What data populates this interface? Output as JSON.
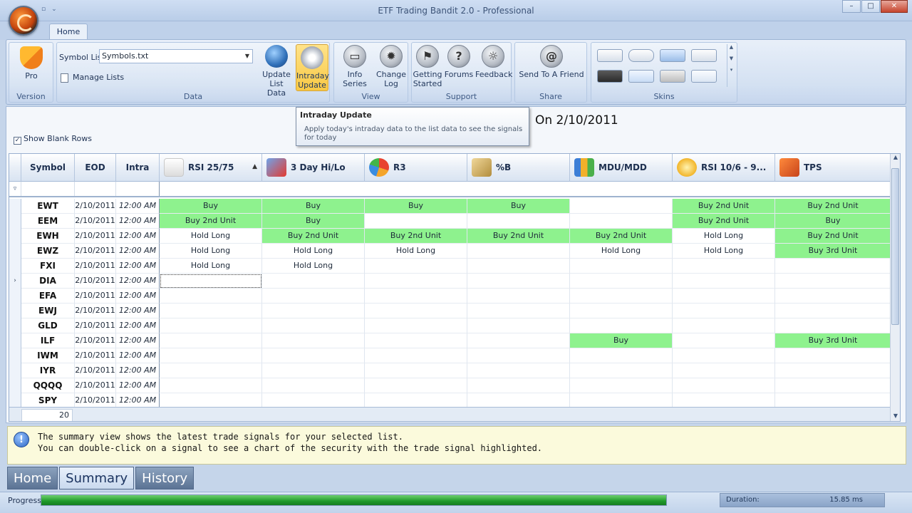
{
  "window": {
    "title": "ETF Trading Bandit 2.0 - Professional",
    "min": "–",
    "max": "□",
    "close": "✕"
  },
  "ribbon": {
    "tab": "Home",
    "groups": {
      "version": {
        "label": "Version",
        "pro": "Pro"
      },
      "data": {
        "label": "Data",
        "symbol_list_label": "Symbol List",
        "symbol_list_value": "Symbols.txt",
        "manage_lists": "Manage Lists",
        "update_list_1": "Update",
        "update_list_2": "List Data",
        "intraday_1": "Intraday",
        "intraday_2": "Update"
      },
      "view": {
        "label": "View",
        "info_series": "Info Series",
        "change_log_1": "Change",
        "change_log_2": "Log"
      },
      "support": {
        "label": "Support",
        "getting_started_1": "Getting",
        "getting_started_2": "Started",
        "forums": "Forums",
        "feedback": "Feedback"
      },
      "share": {
        "label": "Share",
        "send": "Send To A Friend",
        "at": "@"
      },
      "skins": {
        "label": "Skins"
      }
    }
  },
  "tooltip": {
    "title": "Intraday Update",
    "body": "Apply today's intraday data to the list data to see the signals for today"
  },
  "header_date": "On 2/10/2011",
  "show_blank_rows": "Show Blank Rows",
  "columns": {
    "symbol": "Symbol",
    "eod": "EOD",
    "intra": "Intra",
    "rsi2575": "RSI 25/75",
    "hilo": "3 Day Hi/Lo",
    "r3": "R3",
    "pctb": "%B",
    "mdu": "MDU/MDD",
    "rsi106": "RSI 10/6 - 9...",
    "tps": "TPS"
  },
  "rows": [
    {
      "symbol": "EWT",
      "eod": "2/10/2011",
      "intra": "12:00 AM",
      "signals": [
        "Buy",
        "Buy",
        "Buy",
        "Buy",
        "",
        "Buy 2nd Unit",
        "Buy 2nd Unit"
      ],
      "buy": [
        1,
        1,
        1,
        1,
        0,
        1,
        1
      ]
    },
    {
      "symbol": "EEM",
      "eod": "2/10/2011",
      "intra": "12:00 AM",
      "signals": [
        "Buy 2nd Unit",
        "Buy",
        "",
        "",
        "",
        "Buy 2nd Unit",
        "Buy"
      ],
      "buy": [
        1,
        1,
        0,
        0,
        0,
        1,
        1
      ]
    },
    {
      "symbol": "EWH",
      "eod": "2/10/2011",
      "intra": "12:00 AM",
      "signals": [
        "Hold Long",
        "Buy 2nd Unit",
        "Buy 2nd Unit",
        "Buy 2nd Unit",
        "Buy 2nd Unit",
        "Hold Long",
        "Buy 2nd Unit"
      ],
      "buy": [
        0,
        1,
        1,
        1,
        1,
        0,
        1
      ]
    },
    {
      "symbol": "EWZ",
      "eod": "2/10/2011",
      "intra": "12:00 AM",
      "signals": [
        "Hold Long",
        "Hold Long",
        "Hold Long",
        "",
        "Hold Long",
        "Hold Long",
        "Buy 3rd Unit"
      ],
      "buy": [
        0,
        0,
        0,
        0,
        0,
        0,
        1
      ]
    },
    {
      "symbol": "FXI",
      "eod": "2/10/2011",
      "intra": "12:00 AM",
      "signals": [
        "Hold Long",
        "Hold Long",
        "",
        "",
        "",
        "",
        ""
      ],
      "buy": [
        0,
        0,
        0,
        0,
        0,
        0,
        0
      ]
    },
    {
      "symbol": "DIA",
      "eod": "2/10/2011",
      "intra": "12:00 AM",
      "signals": [
        "",
        "",
        "",
        "",
        "",
        "",
        ""
      ],
      "buy": [
        0,
        0,
        0,
        0,
        0,
        0,
        0
      ],
      "current": true
    },
    {
      "symbol": "EFA",
      "eod": "2/10/2011",
      "intra": "12:00 AM",
      "signals": [
        "",
        "",
        "",
        "",
        "",
        "",
        ""
      ],
      "buy": [
        0,
        0,
        0,
        0,
        0,
        0,
        0
      ]
    },
    {
      "symbol": "EWJ",
      "eod": "2/10/2011",
      "intra": "12:00 AM",
      "signals": [
        "",
        "",
        "",
        "",
        "",
        "",
        ""
      ],
      "buy": [
        0,
        0,
        0,
        0,
        0,
        0,
        0
      ]
    },
    {
      "symbol": "GLD",
      "eod": "2/10/2011",
      "intra": "12:00 AM",
      "signals": [
        "",
        "",
        "",
        "",
        "",
        "",
        ""
      ],
      "buy": [
        0,
        0,
        0,
        0,
        0,
        0,
        0
      ]
    },
    {
      "symbol": "ILF",
      "eod": "2/10/2011",
      "intra": "12:00 AM",
      "signals": [
        "",
        "",
        "",
        "",
        "Buy",
        "",
        "Buy 3rd Unit"
      ],
      "buy": [
        0,
        0,
        0,
        0,
        1,
        0,
        1
      ]
    },
    {
      "symbol": "IWM",
      "eod": "2/10/2011",
      "intra": "12:00 AM",
      "signals": [
        "",
        "",
        "",
        "",
        "",
        "",
        ""
      ],
      "buy": [
        0,
        0,
        0,
        0,
        0,
        0,
        0
      ]
    },
    {
      "symbol": "IYR",
      "eod": "2/10/2011",
      "intra": "12:00 AM",
      "signals": [
        "",
        "",
        "",
        "",
        "",
        "",
        ""
      ],
      "buy": [
        0,
        0,
        0,
        0,
        0,
        0,
        0
      ]
    },
    {
      "symbol": "QQQQ",
      "eod": "2/10/2011",
      "intra": "12:00 AM",
      "signals": [
        "",
        "",
        "",
        "",
        "",
        "",
        ""
      ],
      "buy": [
        0,
        0,
        0,
        0,
        0,
        0,
        0
      ]
    },
    {
      "symbol": "SPY",
      "eod": "2/10/2011",
      "intra": "12:00 AM",
      "signals": [
        "",
        "",
        "",
        "",
        "",
        "",
        ""
      ],
      "buy": [
        0,
        0,
        0,
        0,
        0,
        0,
        0
      ]
    }
  ],
  "row_count": "20",
  "info": {
    "line1": "The summary view shows the latest trade signals for your selected list.",
    "line2": "You can double-click on a signal to see a chart of the security with the trade signal highlighted."
  },
  "nav": {
    "home": "Home",
    "summary": "Summary",
    "history": "History"
  },
  "status": {
    "progress_label": "Progress",
    "progress_fraction": 1.0,
    "duration_label": "Duration:",
    "duration_value": "15.85 ms"
  },
  "colors": {
    "buy_green": "#8ef28e",
    "accent": "#c5d5ea"
  }
}
